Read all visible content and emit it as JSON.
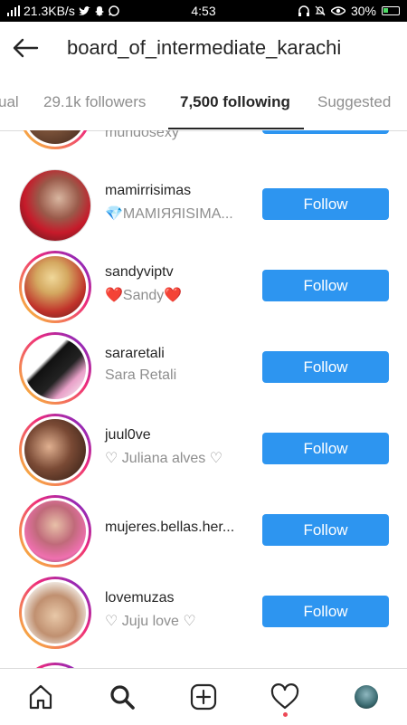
{
  "status_bar": {
    "network": "21.3KB/s",
    "time": "4:53",
    "battery": "30%"
  },
  "header": {
    "title": "board_of_intermediate_karachi"
  },
  "tabs": [
    {
      "label": "ual"
    },
    {
      "label": "29.1k followers"
    },
    {
      "label": "7,500 following",
      "active": true
    },
    {
      "label": "Suggested"
    }
  ],
  "rows": [
    {
      "username": "",
      "fullname": "mundosexy",
      "button": ""
    },
    {
      "username": "mamirrisimas",
      "fullname": "💎MAMIЯЯISIMA...",
      "button": "Follow"
    },
    {
      "username": "sandyviptv",
      "fullname": "❤️Sandy❤️",
      "button": "Follow"
    },
    {
      "username": "sararetali",
      "fullname": "Sara Retali",
      "button": "Follow"
    },
    {
      "username": "juul0ve",
      "fullname": "♡ Juliana alves ♡",
      "button": "Follow"
    },
    {
      "username": "mujeres.bellas.her...",
      "fullname": "",
      "button": "Follow"
    },
    {
      "username": "lovemuzas",
      "fullname": "♡ Juju love  ♡",
      "button": "Follow"
    }
  ],
  "colors": {
    "follow_button": "#2d95f0",
    "story_ring": "#ee2a7b",
    "notification_dot": "#ed4956"
  },
  "nav": [
    {
      "icon": "home-icon"
    },
    {
      "icon": "search-icon",
      "active": true
    },
    {
      "icon": "add-post-icon"
    },
    {
      "icon": "heart-icon",
      "has_notification": true
    },
    {
      "icon": "profile-avatar"
    }
  ]
}
